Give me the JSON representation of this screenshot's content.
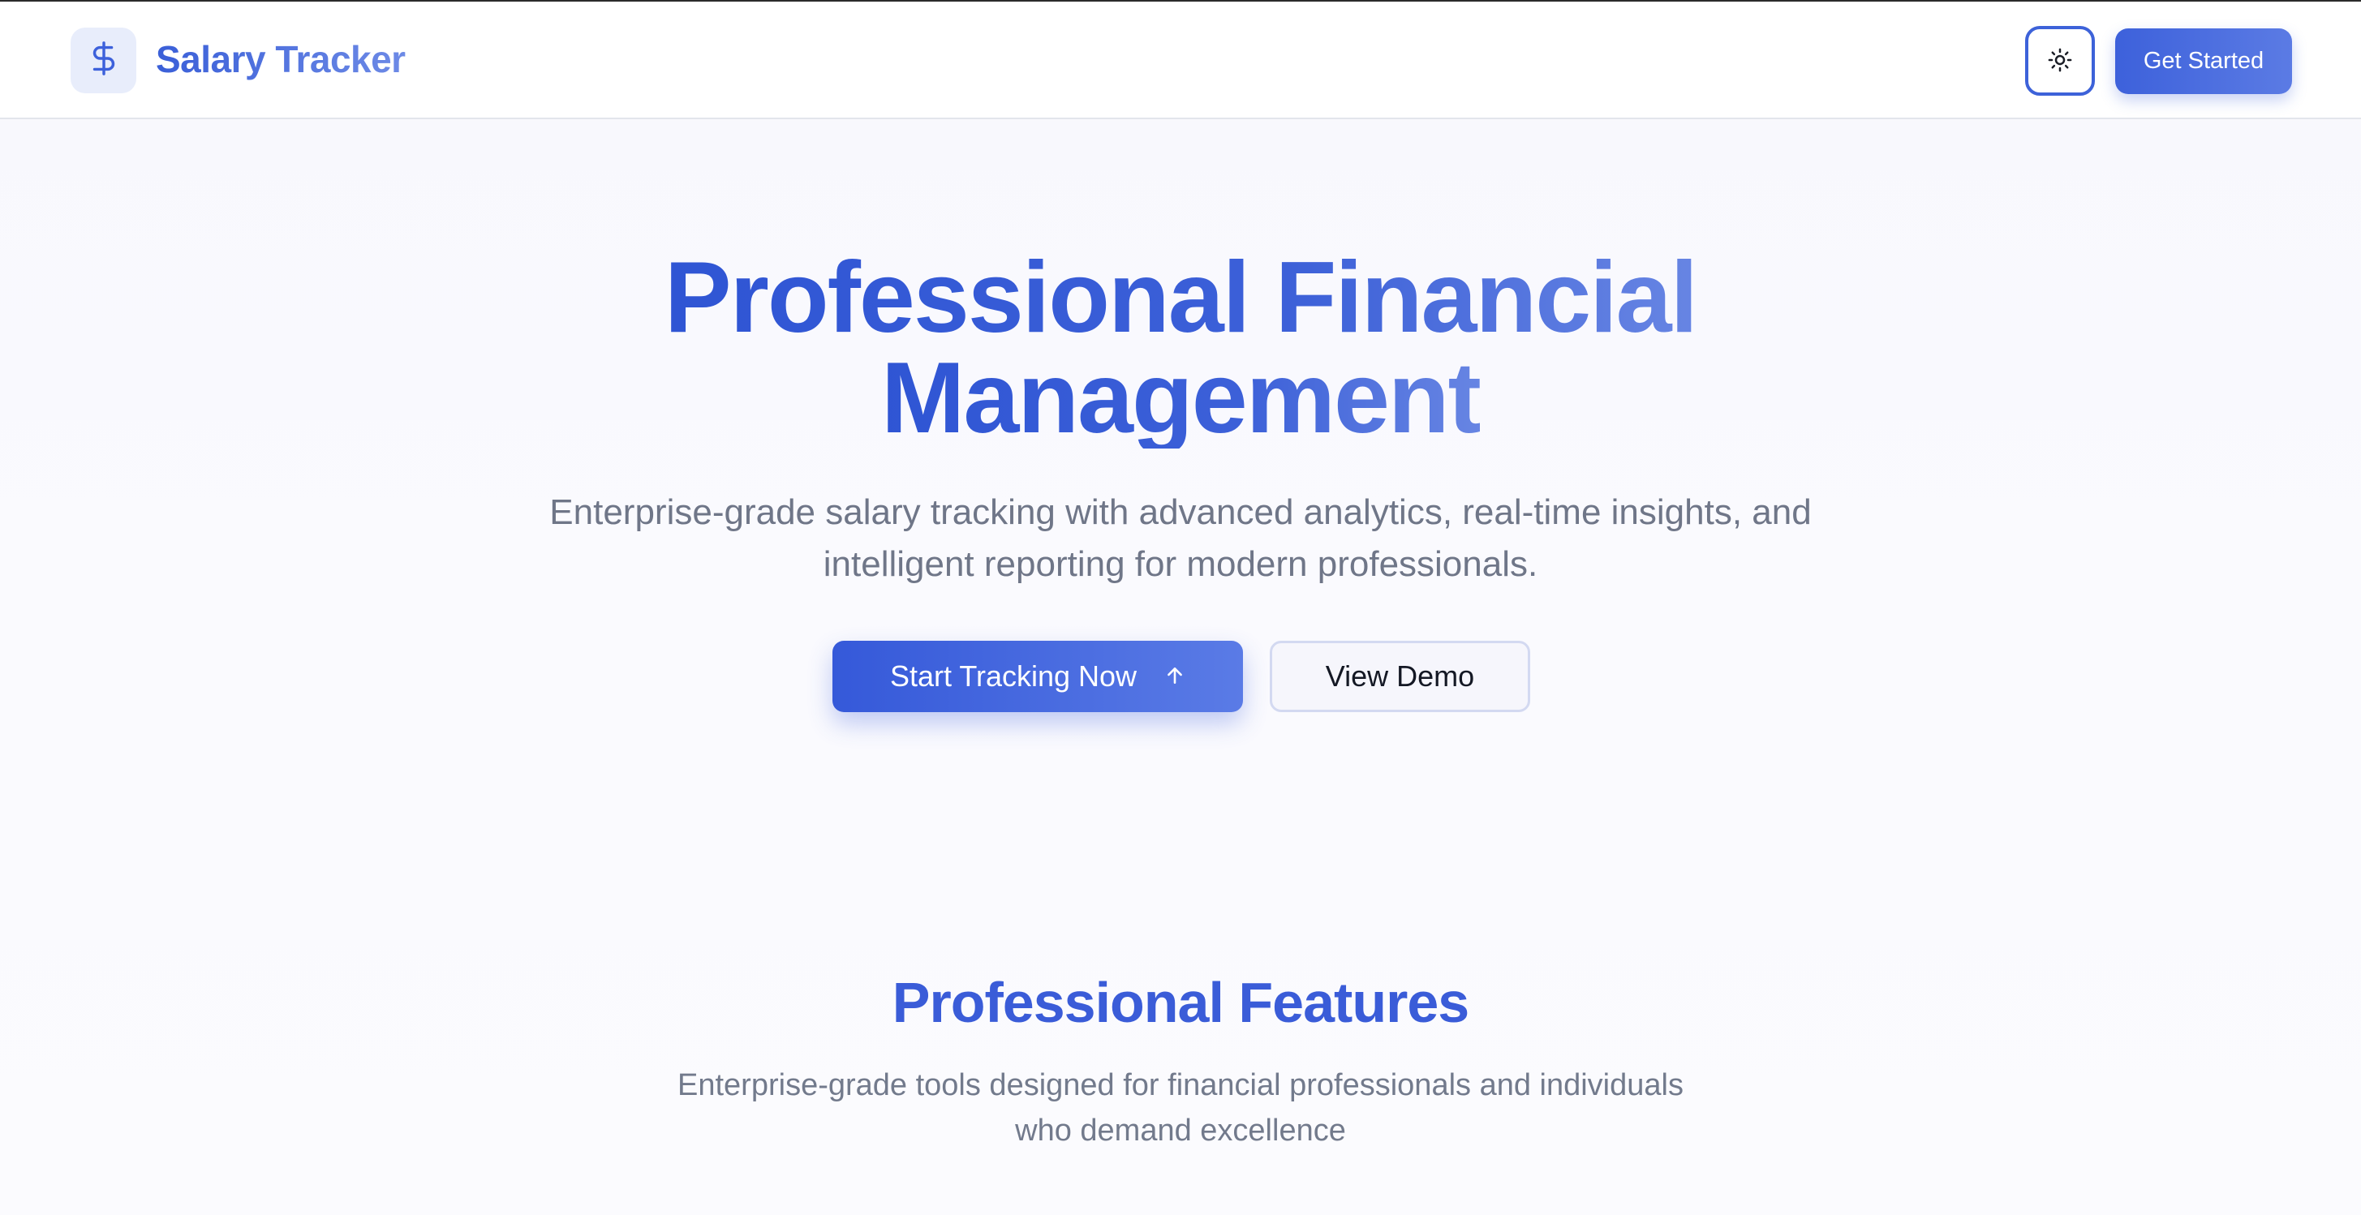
{
  "header": {
    "brand": "Salary Tracker",
    "logo_icon": "dollar-sign-icon",
    "theme_icon": "sun-icon",
    "get_started_label": "Get Started"
  },
  "hero": {
    "title_line1": "Professional Financial",
    "title_line2": "Management",
    "subtitle_line1": "Enterprise-grade salary tracking with advanced analytics, real-time insights, and",
    "subtitle_line2": "intelligent reporting for modern professionals.",
    "primary_cta": "Start Tracking Now",
    "primary_cta_icon": "arrow-up-icon",
    "secondary_cta": "View Demo"
  },
  "features": {
    "title": "Professional Features",
    "subtitle_line1": "Enterprise-grade tools designed for financial professionals and individuals",
    "subtitle_line2": "who demand excellence"
  },
  "colors": {
    "accent": "#3d61db",
    "accent_light": "#6d8ae6",
    "text_muted": "#6f7688",
    "logo_bg": "#e8edfb"
  }
}
